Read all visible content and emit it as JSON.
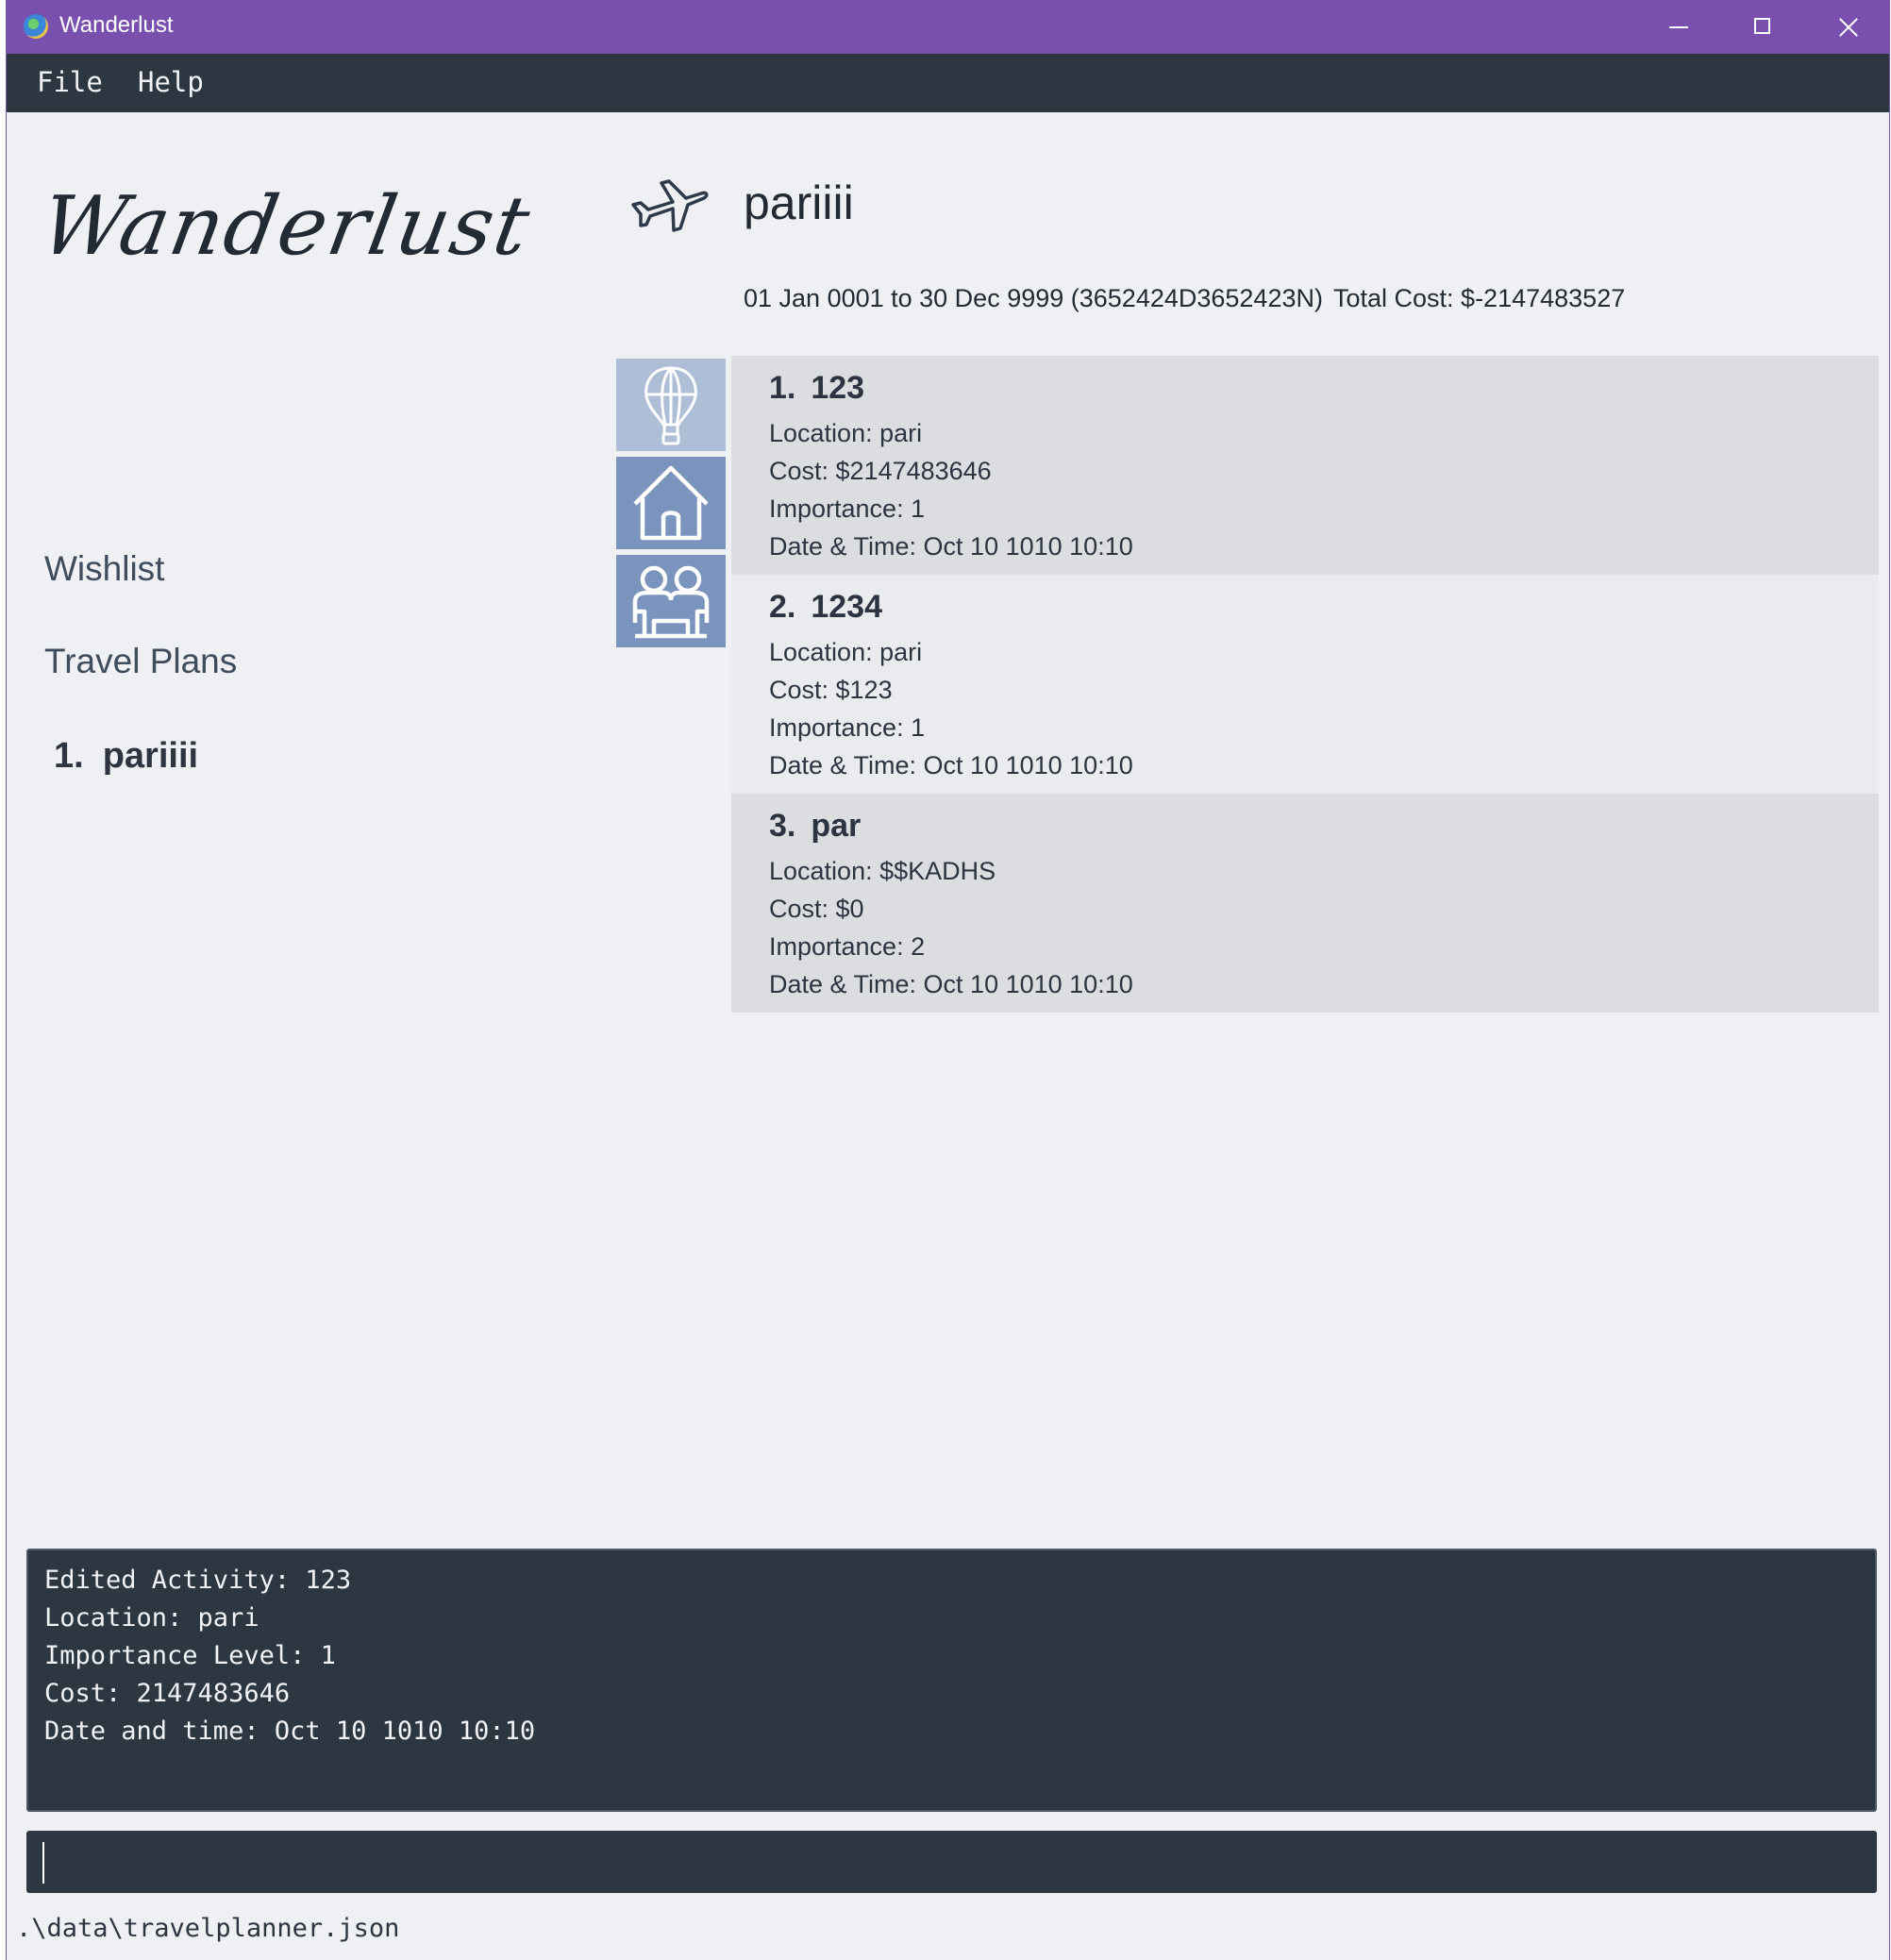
{
  "window": {
    "title": "Wanderlust",
    "icon": "globe-icon",
    "controls": [
      "minimize-icon",
      "maximize-icon",
      "close-icon"
    ]
  },
  "menu": {
    "file": "File",
    "help": "Help"
  },
  "sidebar": {
    "logo": "Wanderlust",
    "wishlist_label": "Wishlist",
    "travel_plans_label": "Travel Plans",
    "plans": [
      {
        "index": "1.",
        "name": "pariiii"
      }
    ]
  },
  "header": {
    "icon": "airplane-icon",
    "title": "pariiii",
    "dates": "01 Jan 0001 to 30 Dec 9999 (3652424D3652423N)",
    "total_cost": "Total Cost: $-2147483527"
  },
  "tabs": [
    {
      "icon": "hot-air-balloon-icon",
      "color": "#aebed7"
    },
    {
      "icon": "house-icon",
      "color": "#7b94bd"
    },
    {
      "icon": "friends-icon",
      "color": "#7b94bd"
    }
  ],
  "activities": [
    {
      "index": "1.",
      "name": "123",
      "location": "Location: pari",
      "cost": "Cost: $2147483646",
      "importance": "Importance: 1",
      "datetime": "Date & Time: Oct 10 1010 10:10"
    },
    {
      "index": "2.",
      "name": "1234",
      "location": "Location: pari",
      "cost": "Cost: $123",
      "importance": "Importance: 1",
      "datetime": "Date & Time: Oct 10 1010 10:10"
    },
    {
      "index": "3.",
      "name": "par",
      "location": "Location: $$KADHS",
      "cost": "Cost: $0",
      "importance": "Importance: 2",
      "datetime": "Date & Time: Oct 10 1010 10:10"
    }
  ],
  "result": {
    "lines": [
      "Edited Activity: 123",
      "Location: pari",
      "Importance Level: 1",
      "Cost: 2147483646",
      "Date and time: Oct 10 1010 10:10"
    ]
  },
  "command": {
    "value": "",
    "placeholder": ""
  },
  "status": {
    "path": ".\\data\\travelplanner.json"
  },
  "colors": {
    "titlebar": "#7950ad",
    "menubar": "#2c3742",
    "background": "#eef0f4",
    "card_odd": "#dcdde1",
    "card_even": "#eaebee"
  }
}
